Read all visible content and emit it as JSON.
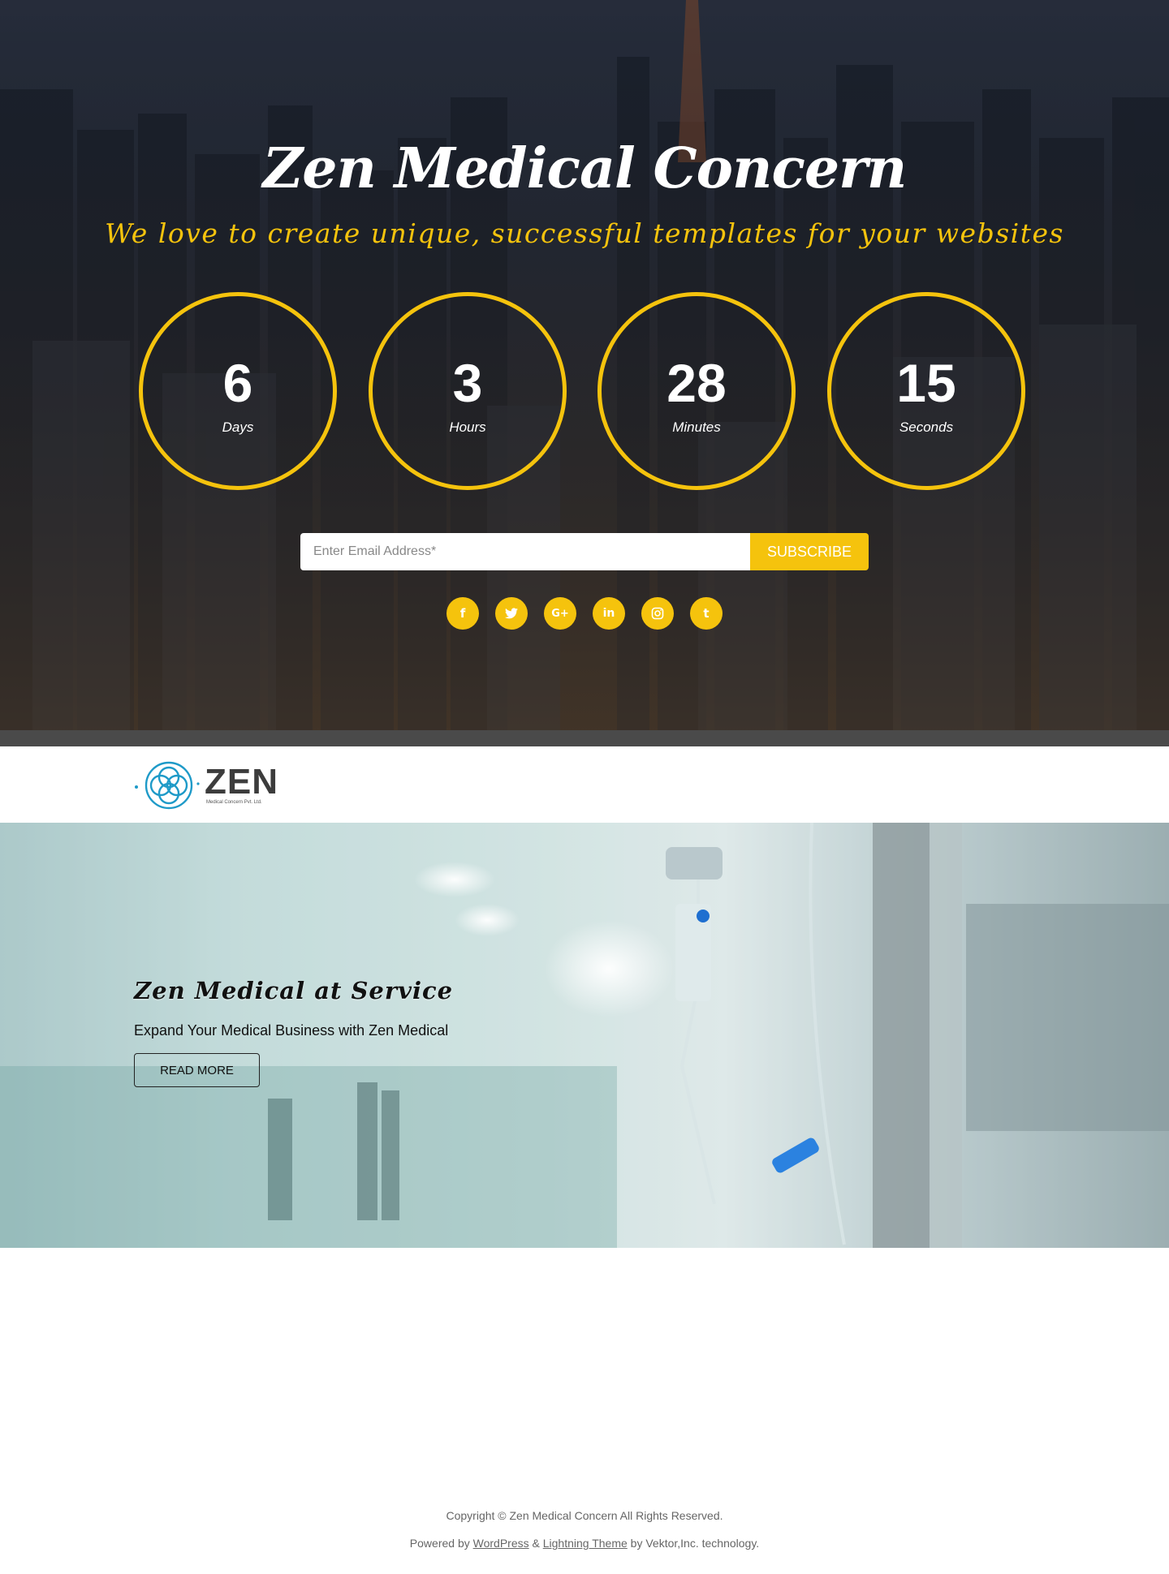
{
  "hero": {
    "title": "Zen Medical Concern",
    "tagline": "We love to create unique, successful templates for your websites",
    "accent_color": "#f5c30d",
    "countdown": [
      {
        "value": "6",
        "label": "Days"
      },
      {
        "value": "3",
        "label": "Hours"
      },
      {
        "value": "28",
        "label": "Minutes"
      },
      {
        "value": "15",
        "label": "Seconds"
      }
    ],
    "subscribe": {
      "placeholder": "Enter Email Address*",
      "button_label": "SUBSCRIBE"
    },
    "social": [
      {
        "icon": "facebook-icon",
        "glyph": "f"
      },
      {
        "icon": "twitter-icon",
        "glyph": "🐦"
      },
      {
        "icon": "google-plus-icon",
        "glyph": "G+"
      },
      {
        "icon": "linkedin-icon",
        "glyph": "in"
      },
      {
        "icon": "instagram-icon",
        "glyph": "◎"
      },
      {
        "icon": "tumblr-icon",
        "glyph": "t"
      }
    ]
  },
  "header": {
    "logo_word": "ZEN",
    "logo_subtitle": "Medical Concern Pvt. Ltd.",
    "logo_color": "#1e9ac8"
  },
  "slider": {
    "title": "Zen Medical at Service",
    "text": "Expand Your Medical Business with Zen Medical",
    "button_label": "READ MORE"
  },
  "footer": {
    "copyright": "Copyright © Zen Medical Concern All Rights Reserved.",
    "powered_prefix": "Powered by ",
    "wordpress": "WordPress",
    "amp": " & ",
    "theme": "Lightning Theme",
    "powered_suffix": " by Vektor,Inc. technology."
  }
}
